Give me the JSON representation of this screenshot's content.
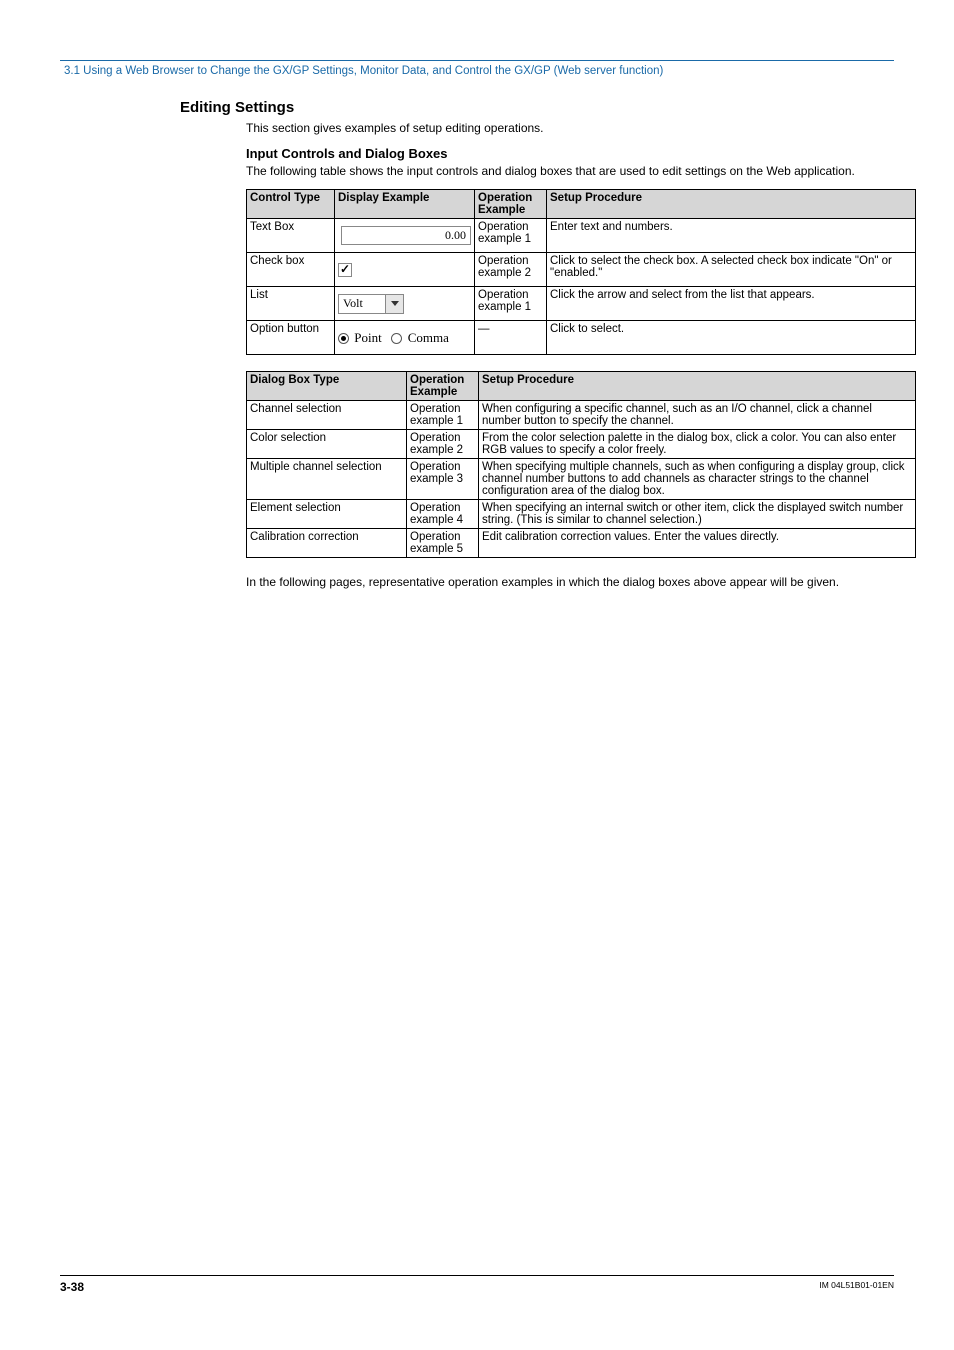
{
  "header_breadcrumb": "3.1  Using a Web Browser to Change the GX/GP Settings, Monitor Data, and Control the GX/GP (Web server function)",
  "editing_settings": {
    "heading": "Editing Settings",
    "intro": "This section gives examples of setup editing operations.",
    "input_controls": {
      "heading": "Input Controls and Dialog Boxes",
      "intro": "The following table shows the input controls and dialog boxes that are used to edit settings on the Web application.",
      "table1": {
        "headers": [
          "Control Type",
          "Display Example",
          "Operation Example",
          "Setup Procedure"
        ],
        "rows": [
          {
            "control_type": "Text Box",
            "display_example_text": "0.00",
            "operation_example": "Operation example 1",
            "setup_procedure": "Enter text and numbers."
          },
          {
            "control_type": "Check box",
            "operation_example": "Operation example 2",
            "setup_procedure": "Click to select the check box. A selected check box indicate \"On\" or \"enabled.\""
          },
          {
            "control_type": "List",
            "display_example_text": "Volt",
            "operation_example": "Operation example 1",
            "setup_procedure": "Click the arrow and select from the list that appears."
          },
          {
            "control_type": "Option button",
            "display_example_option1": "Point",
            "display_example_option2": "Comma",
            "operation_example": "—",
            "setup_procedure": "Click to select."
          }
        ]
      },
      "table2": {
        "headers": [
          "Dialog Box Type",
          "Operation Example",
          "Setup Procedure"
        ],
        "rows": [
          {
            "dialog_box_type": "Channel selection",
            "operation_example": "Operation example 1",
            "setup_procedure": "When configuring a specific channel, such as an I/O channel, click a channel number button to specify the channel."
          },
          {
            "dialog_box_type": "Color selection",
            "operation_example": "Operation example 2",
            "setup_procedure": "From the color selection palette in the dialog box, click a color. You can also enter RGB values to specify a color freely."
          },
          {
            "dialog_box_type": "Multiple channel selection",
            "operation_example": "Operation example 3",
            "setup_procedure": "When specifying multiple channels, such as when configuring a display group, click channel number buttons to add channels as character strings to the channel configuration area of the dialog box."
          },
          {
            "dialog_box_type": "Element selection",
            "operation_example": "Operation example 4",
            "setup_procedure": "When specifying an internal switch or other item, click the displayed switch number string. (This is similar to channel selection.)"
          },
          {
            "dialog_box_type": "Calibration correction",
            "operation_example": "Operation example 5",
            "setup_procedure": "Edit calibration correction values. Enter the values directly."
          }
        ]
      },
      "outro": "In the following pages, representative operation examples in which the dialog boxes above appear will be given."
    }
  },
  "footer": {
    "page_number": "3-38",
    "doc_id": "IM 04L51B01-01EN"
  }
}
